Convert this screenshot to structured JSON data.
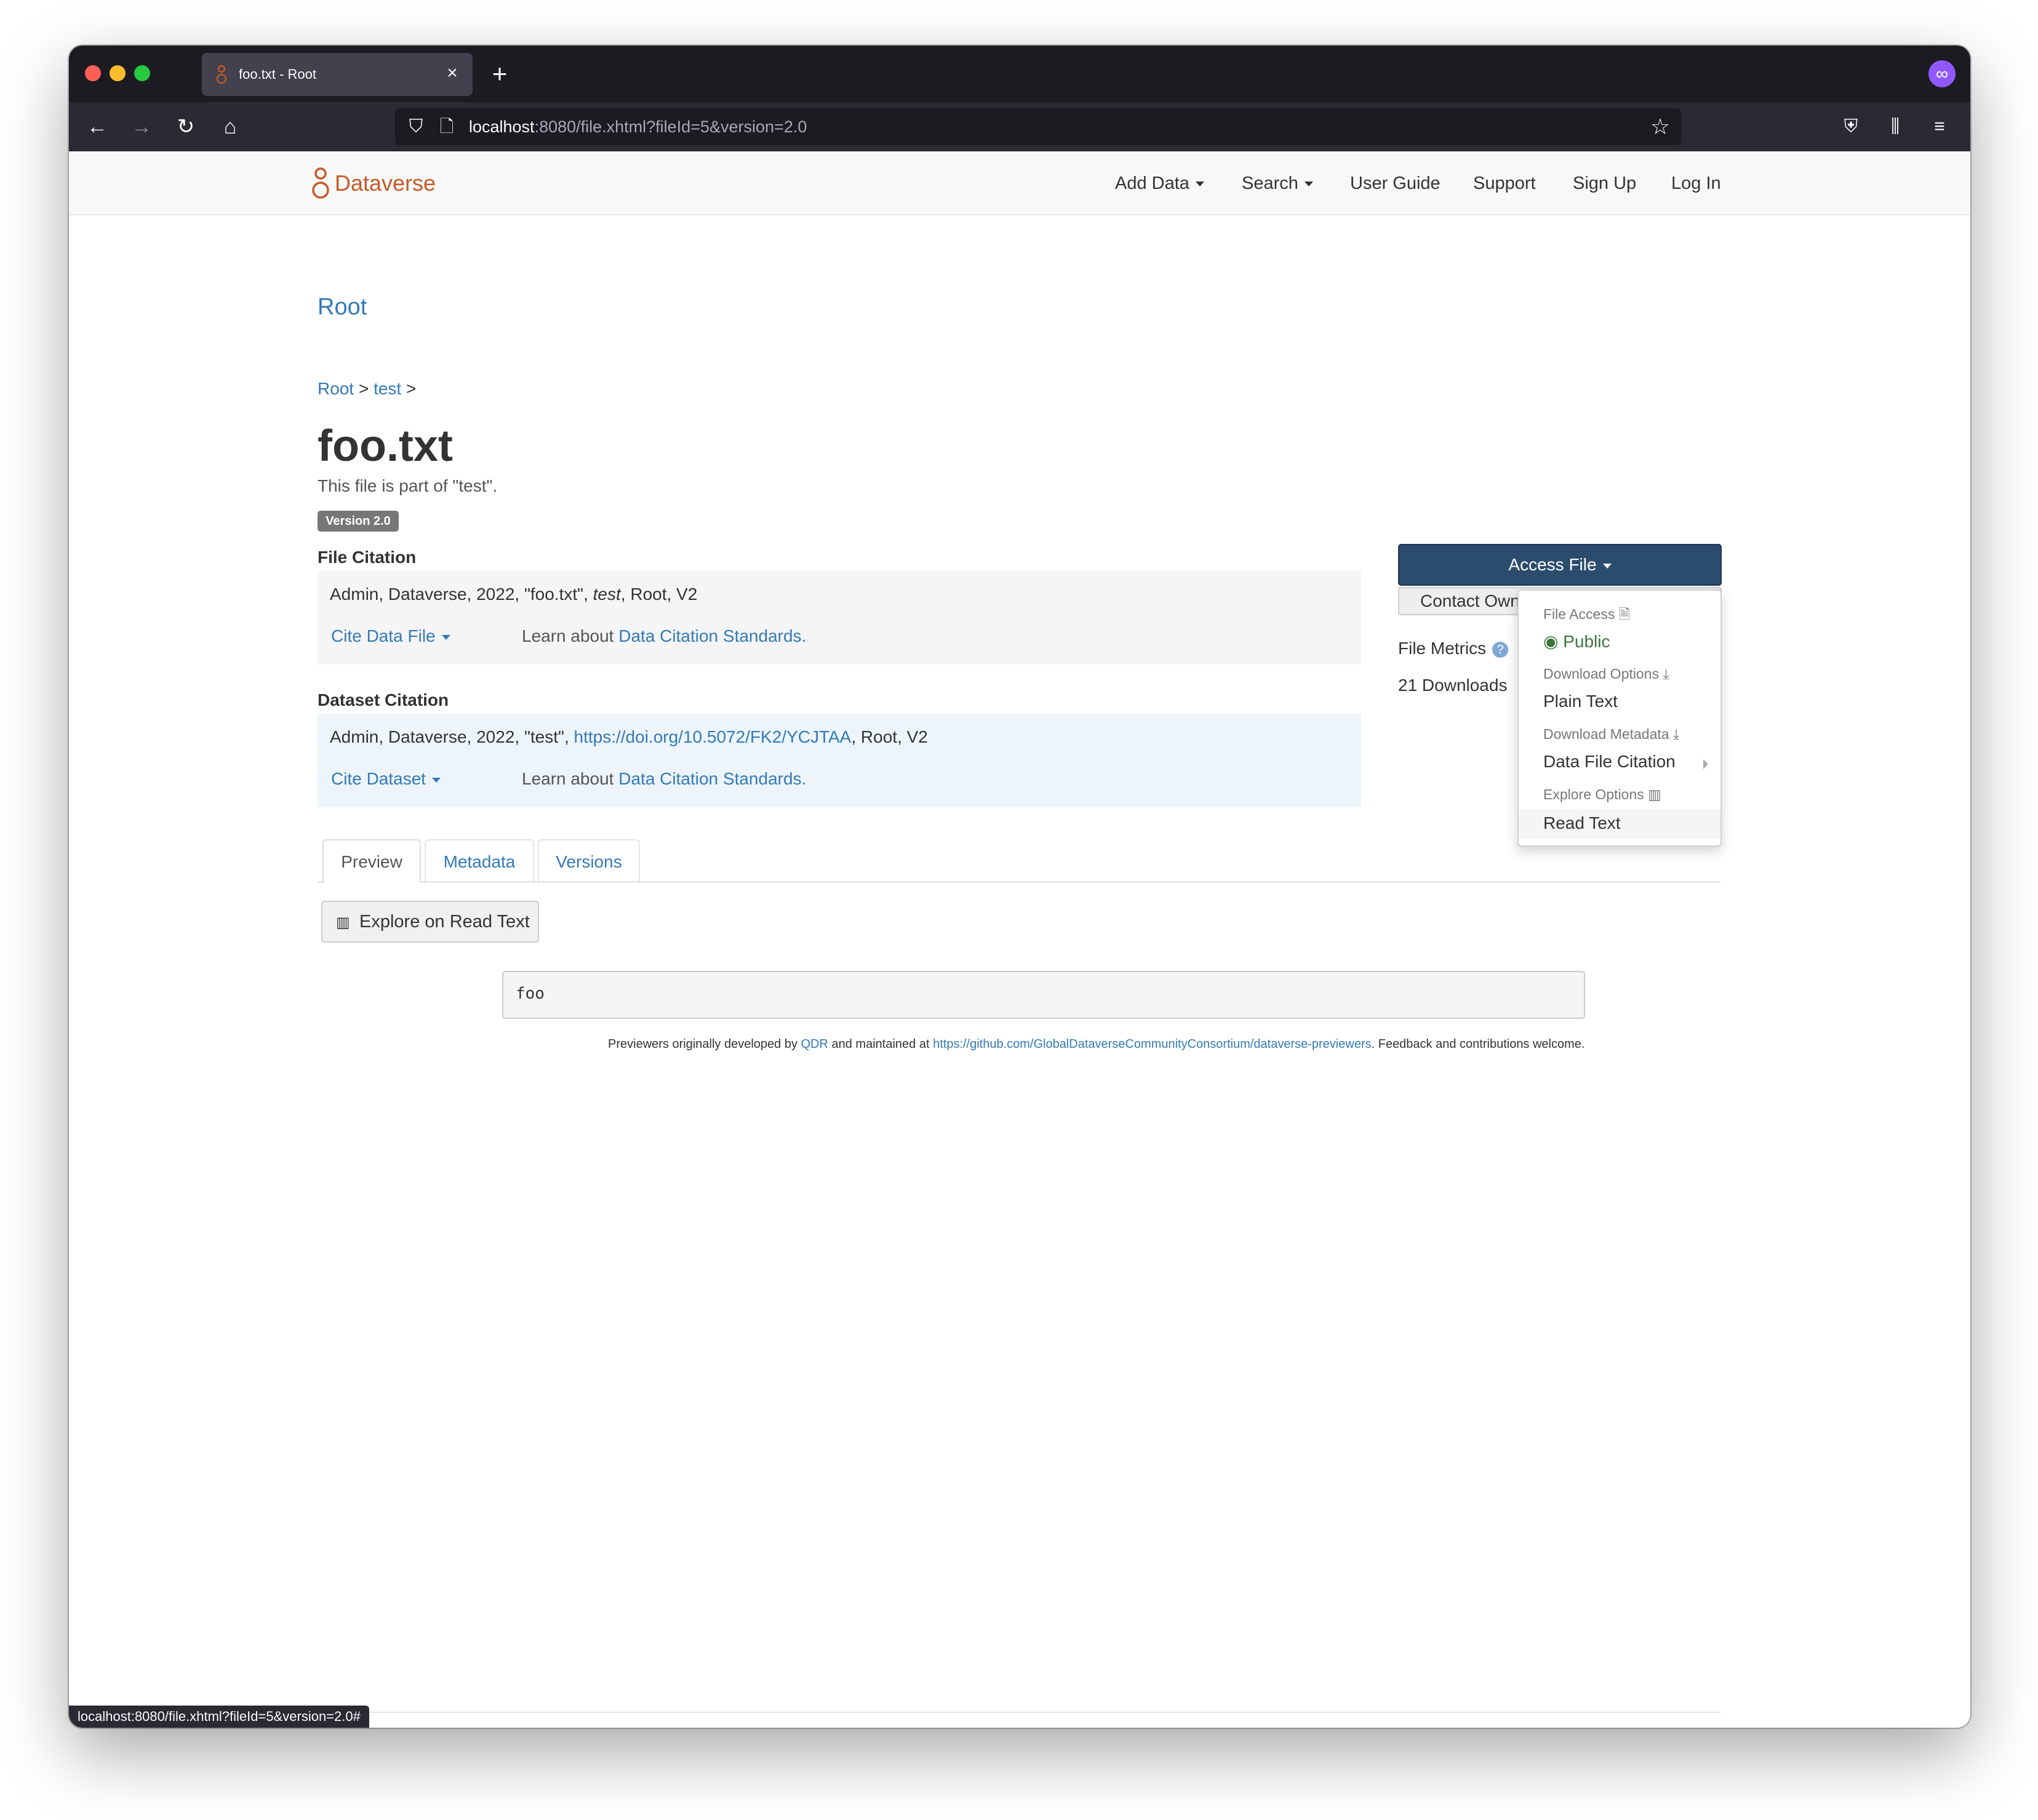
{
  "browser": {
    "tab_title": "foo.txt - Root",
    "tab_close": "×",
    "new_tab": "+",
    "url_host": "localhost",
    "url_rest": ":8080/file.xhtml?fileId=5&version=2.0",
    "status_url": "localhost:8080/file.xhtml?fileId=5&version=2.0#",
    "icons": {
      "back": "arrow-left-icon",
      "forward": "arrow-right-icon",
      "reload": "reload-icon",
      "home": "home-icon",
      "shield": "shield-icon",
      "page": "page-icon",
      "bookmark": "star-icon",
      "pocket": "pocket-icon",
      "library": "library-icon",
      "menu": "hamburger-menu-icon",
      "extension": "extension-icon"
    },
    "traffic_lights": [
      "#ff5f57",
      "#febc2e",
      "#28c840"
    ]
  },
  "site": {
    "brand": "Dataverse",
    "brand_color": "#c55b28",
    "nav": {
      "add_data": "Add Data",
      "search": "Search",
      "user_guide": "User Guide",
      "support": "Support",
      "sign_up": "Sign Up",
      "log_in": "Log In"
    },
    "dataverse_name": "Root"
  },
  "breadcrumb": {
    "root": "Root",
    "sep1": ">",
    "test": "test",
    "sep2": ">"
  },
  "file": {
    "title": "foo.txt",
    "part_of": "This file is part of \"test\".",
    "version_badge": "Version 2.0"
  },
  "file_citation": {
    "heading": "File Citation",
    "text_before": "Admin, Dataverse, 2022, \"foo.txt\", ",
    "text_italic": "test",
    "text_after": ", Root, V2",
    "cite_button": "Cite Data File",
    "learn_prefix": "Learn about",
    "learn_link": "Data Citation Standards."
  },
  "dataset_citation": {
    "heading": "Dataset Citation",
    "text_before": "Admin, Dataverse, 2022, \"test\", ",
    "doi_link": "https://doi.org/10.5072/FK2/YCJTAA",
    "text_after": ", Root, V2",
    "cite_button": "Cite Dataset",
    "learn_prefix": "Learn about",
    "learn_link": "Data Citation Standards."
  },
  "sidebar": {
    "access_file": "Access File",
    "contact_owner": "Contact Owner",
    "file_metrics": "File Metrics",
    "downloads": "21 Downloads",
    "help_icon": "question-circle-icon"
  },
  "access_menu": {
    "file_access_header": "File Access",
    "public": "Public",
    "download_options_header": "Download Options",
    "plain_text": "Plain Text",
    "download_metadata_header": "Download Metadata",
    "data_file_citation": "Data File Citation",
    "explore_options_header": "Explore Options",
    "read_text": "Read Text"
  },
  "tabs": {
    "preview": "Preview",
    "metadata": "Metadata",
    "versions": "Versions"
  },
  "preview": {
    "explore_button": "Explore on Read Text",
    "content": "foo",
    "footer_prefix": "Previewers originally developed by ",
    "footer_qdr": "QDR",
    "footer_mid": " and maintained at ",
    "footer_link": "https://github.com/GlobalDataverseCommunityConsortium/dataverse-previewers",
    "footer_suffix": ". Feedback and contributions welcome."
  }
}
